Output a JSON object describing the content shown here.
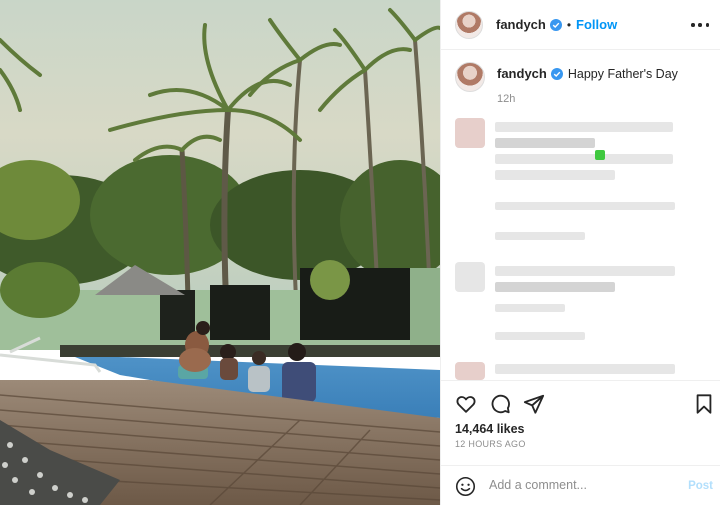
{
  "post": {
    "username": "fandych",
    "follow_label": "Follow",
    "separator": "•",
    "caption_text": "Happy Father's Day",
    "caption_time": "12h",
    "likes": "14,464 likes",
    "posted_ago": "12 HOURS AGO"
  },
  "comment_box": {
    "placeholder": "Add a comment...",
    "post_label": "Post"
  },
  "colors": {
    "accent": "#0095f6",
    "post_disabled": "#b2dffc",
    "verified": "#3897f0"
  },
  "icons": [
    "more-icon",
    "verified-badge-icon",
    "heart-icon",
    "comment-icon",
    "share-icon",
    "bookmark-icon",
    "emoji-icon"
  ]
}
